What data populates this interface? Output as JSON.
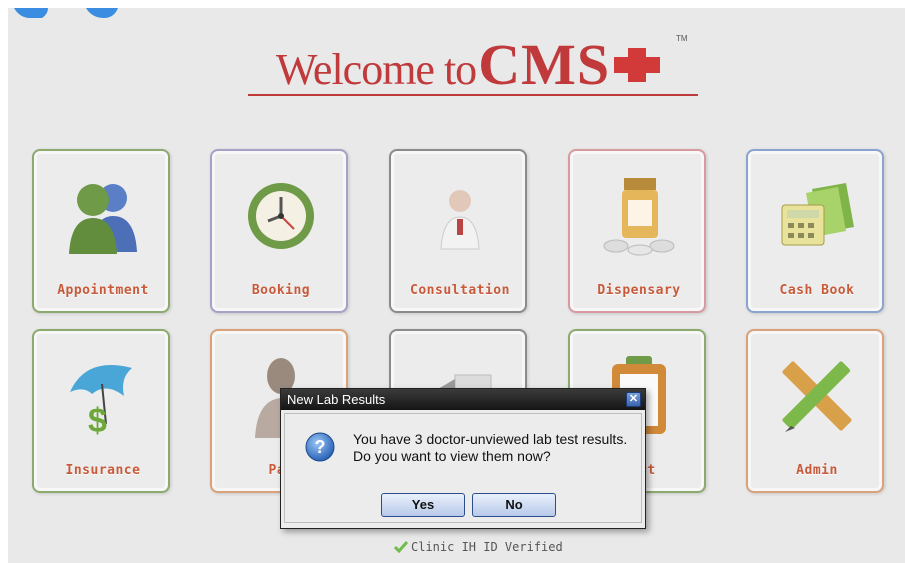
{
  "header": {
    "welcome": "Welcome to",
    "brand": "CMS",
    "trademark": "TM",
    "accent_color": "#c0393b"
  },
  "tiles": [
    {
      "label": "Appointment",
      "icon": "people-icon"
    },
    {
      "label": "Booking",
      "icon": "clock-icon"
    },
    {
      "label": "Consultation",
      "icon": "doctor-icon"
    },
    {
      "label": "Dispensary",
      "icon": "pill-bottle-icon"
    },
    {
      "label": "Cash Book",
      "icon": "calculator-icon"
    },
    {
      "label": "Insurance",
      "icon": "umbrella-dollar-icon"
    },
    {
      "label": "Pat",
      "icon": "patient-icon"
    },
    {
      "label": "",
      "icon": "arrow-icon"
    },
    {
      "label": "port",
      "icon": "clipboard-icon"
    },
    {
      "label": "Admin",
      "icon": "pencil-ruler-icon"
    }
  ],
  "dialog": {
    "title": "New Lab Results",
    "message_line1": "You have 3 doctor-unviewed lab test results.",
    "message_line2": "Do you want to view them now?",
    "yes_label": "Yes",
    "no_label": "No",
    "close_label": "✕"
  },
  "footer": {
    "status": "Clinic IH ID Verified",
    "check_color": "#6bbf4a"
  }
}
